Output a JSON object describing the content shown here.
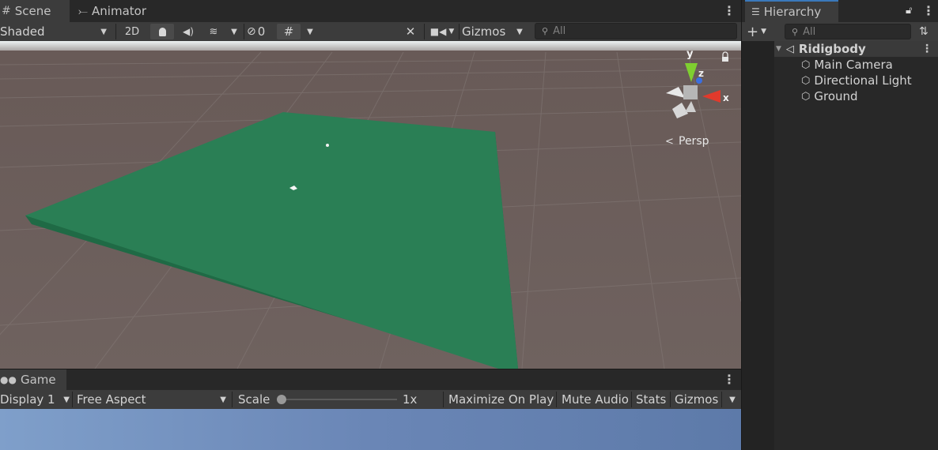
{
  "scene_window": {
    "tabs": [
      {
        "label": "Scene",
        "icon": "grid-icon",
        "active": true
      },
      {
        "label": "Animator",
        "icon": "animator-icon",
        "active": false
      }
    ],
    "toolbar": {
      "draw_mode": "Shaded",
      "toggle_2d": "2D",
      "hidden_count": "0",
      "gizmos_label": "Gizmos",
      "search_placeholder": "All"
    },
    "persp_label": "Persp",
    "axis_labels": {
      "x": "x",
      "y": "y",
      "z": "z"
    },
    "colors": {
      "ground": "#2a7f55",
      "floor": "#6d5f5c",
      "sky": "#e6eeee"
    }
  },
  "hierarchy": {
    "tab_label": "Hierarchy",
    "search_placeholder": "All",
    "scene_name": "Ridigbody",
    "items": [
      {
        "label": "Main Camera"
      },
      {
        "label": "Directional Light"
      },
      {
        "label": "Ground"
      }
    ]
  },
  "game_window": {
    "tab_label": "Game",
    "display": "Display 1",
    "aspect": "Free Aspect",
    "scale_label": "Scale",
    "scale_value": "1x",
    "scale_level": 0,
    "maximize_label": "Maximize On Play",
    "mute_label": "Mute Audio",
    "stats_label": "Stats",
    "gizmos_label": "Gizmos"
  }
}
